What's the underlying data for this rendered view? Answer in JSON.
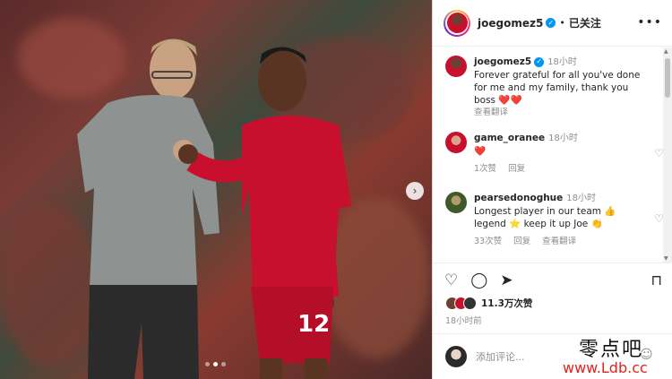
{
  "post": {
    "author": "joegomez5",
    "follow_state": "已关注",
    "separator": "•",
    "more_icon": "more-horizontal-icon",
    "verified_icon": "verified-badge-icon"
  },
  "caption": {
    "username": "joegomez5",
    "time": "18小时",
    "text": "Forever grateful for all you've done for me and my family, thank you boss",
    "emoji": "❤️❤️",
    "translate": "查看翻译"
  },
  "comments": [
    {
      "username": "game_oranee",
      "time": "18小时",
      "text": "",
      "emoji": "❤️",
      "likes": "1次赞",
      "reply": "回复",
      "translate": ""
    },
    {
      "username": "pearsedonoghue",
      "time": "18小时",
      "text": "Longest player in our team 👍 legend ⭐ keep it up Joe 👏",
      "emoji": "",
      "likes": "33次赞",
      "reply": "回复",
      "translate": "查看翻译"
    }
  ],
  "actions": {
    "like_icon": "heart-icon",
    "comment_icon": "comment-icon",
    "share_icon": "send-icon",
    "save_icon": "bookmark-icon"
  },
  "likes_text": "11.3万次赞",
  "post_time": "18小时前",
  "comment_input": {
    "placeholder": "添加评论..."
  },
  "watermark": {
    "line1": "零点吧",
    "line2": "www.Ldb.cc"
  },
  "photo": {
    "carousel_dots": 3,
    "active_dot": 1,
    "shirt_number": "12"
  }
}
